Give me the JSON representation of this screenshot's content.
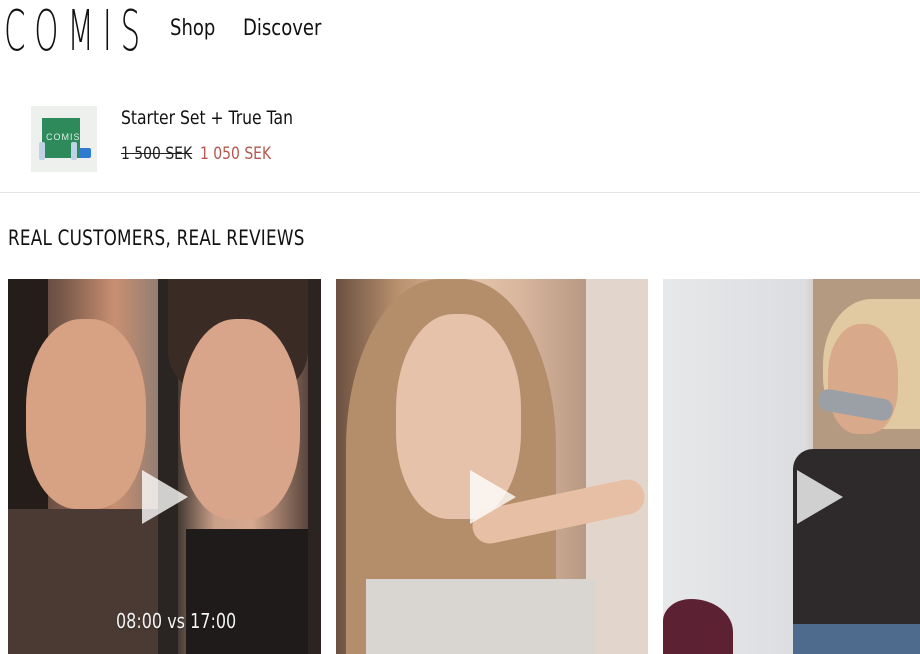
{
  "header": {
    "logo": "COMIS",
    "nav": [
      {
        "label": "Shop"
      },
      {
        "label": "Discover"
      }
    ]
  },
  "product_bar": {
    "name": "Starter Set + True Tan",
    "price_original": "1 500 SEK",
    "price_sale": "1 050 SEK",
    "thumbnail_label": "COMIS",
    "sale_color": "#b5574f"
  },
  "reviews": {
    "title": "REAL CUSTOMERS, REAL REVIEWS",
    "videos": [
      {
        "caption": "08:00 vs 17:00",
        "icon": "play-icon"
      },
      {
        "caption": "",
        "icon": "play-icon"
      },
      {
        "caption": "",
        "icon": "play-icon"
      }
    ]
  }
}
